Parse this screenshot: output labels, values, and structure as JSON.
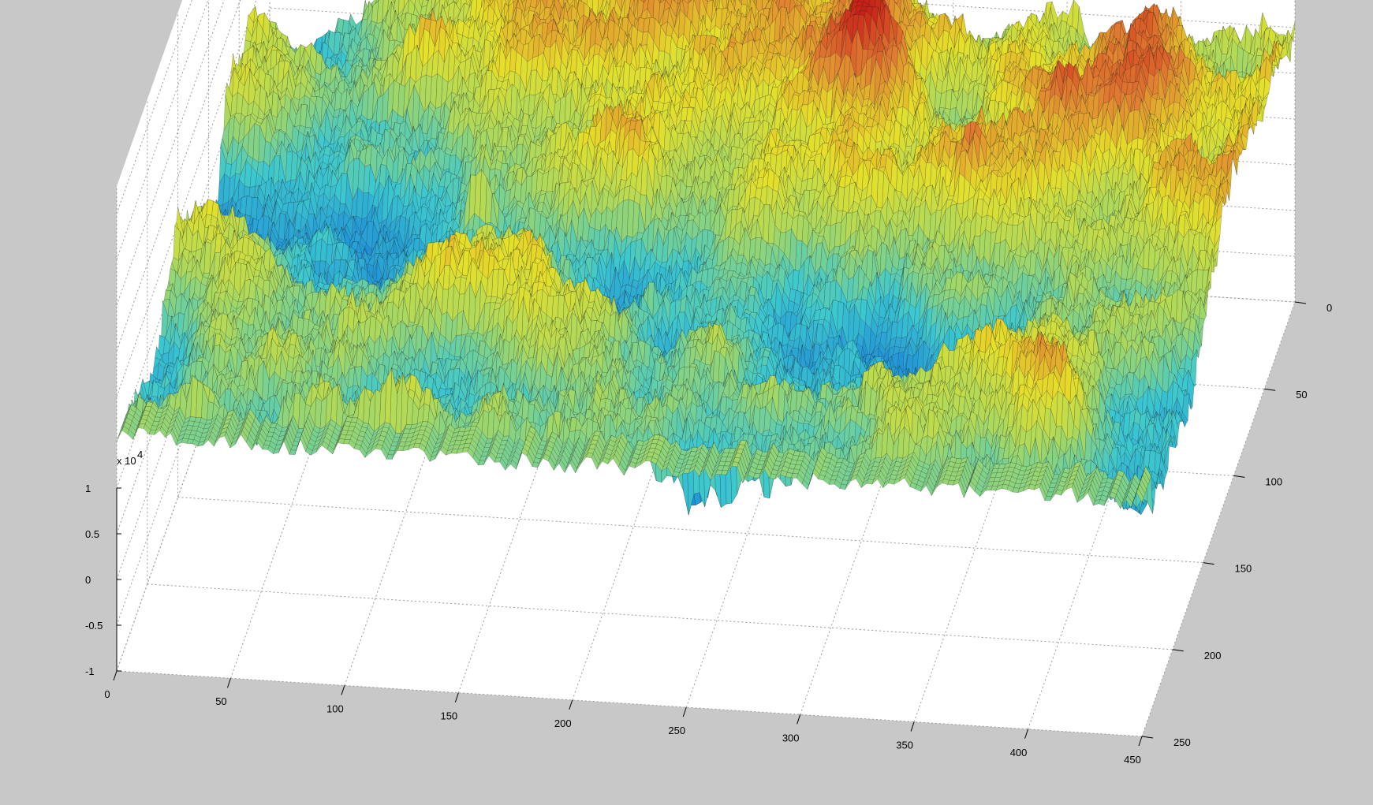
{
  "chart_data": {
    "type": "surface",
    "title": "",
    "xlabel": "",
    "ylabel": "",
    "zlabel": "",
    "x_ticks": [
      0,
      50,
      100,
      150,
      200,
      250,
      300,
      350,
      400,
      450
    ],
    "y_ticks": [
      0,
      50,
      100,
      150,
      200,
      250
    ],
    "z_ticks": [
      -1,
      -0.5,
      0,
      0.5,
      1
    ],
    "z_exponent": "x 10",
    "z_exponent_power": "4",
    "xlim": [
      0,
      450
    ],
    "ylim": [
      0,
      250
    ],
    "zlim": [
      -10000,
      10000
    ],
    "grid": true,
    "colormap": "jet",
    "surface_description_colors": [
      "#0a3ea8",
      "#1e90d8",
      "#3cc8d0",
      "#a8d860",
      "#e6e02a",
      "#e07a30",
      "#c82018"
    ],
    "background_color": "#c8c8c8",
    "axes_color": "#ffffff"
  }
}
